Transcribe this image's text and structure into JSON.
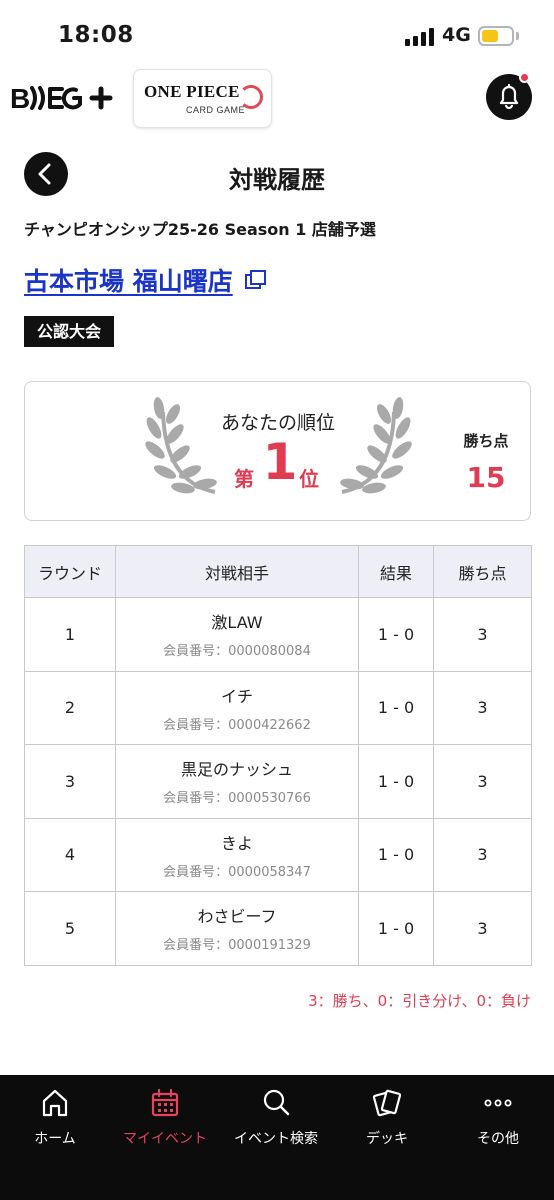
{
  "status_bar": {
    "time": "18:08",
    "network": "4G"
  },
  "header": {
    "brand_logo": "B#SG+",
    "game_logo_title": "ONE PIECE",
    "game_logo_subtitle": "CARD GAME",
    "bell_icon": "bell-icon"
  },
  "page": {
    "title": "対戦履歴",
    "event_name": "チャンピオンシップ25-26 Season 1 店舗予選",
    "store_name": "古本市場 福山曙店",
    "badge": "公認大会"
  },
  "rank_card": {
    "label": "あなたの順位",
    "prefix": "第",
    "rank": "1",
    "suffix": "位",
    "points_label": "勝ち点",
    "points_value": "15"
  },
  "table": {
    "headers": {
      "round": "ラウンド",
      "opponent": "対戦相手",
      "result": "結果",
      "points": "勝ち点"
    },
    "rows": [
      {
        "round": "1",
        "opponent": "激LAW",
        "member_id": "会員番号：0000080084",
        "result": "1 - 0",
        "points": "3"
      },
      {
        "round": "2",
        "opponent": "イチ",
        "member_id": "会員番号：0000422662",
        "result": "1 - 0",
        "points": "3"
      },
      {
        "round": "3",
        "opponent": "黒足のナッシュ",
        "member_id": "会員番号：0000530766",
        "result": "1 - 0",
        "points": "3"
      },
      {
        "round": "4",
        "opponent": "きよ",
        "member_id": "会員番号：0000058347",
        "result": "1 - 0",
        "points": "3"
      },
      {
        "round": "5",
        "opponent": "わさビーフ",
        "member_id": "会員番号：0000191329",
        "result": "1 - 0",
        "points": "3"
      }
    ]
  },
  "legend_note": "3：勝ち、0：引き分け、0：負け",
  "bottom_nav": [
    {
      "label": "ホーム",
      "icon": "home-icon"
    },
    {
      "label": "マイイベント",
      "icon": "calendar-icon",
      "active": true
    },
    {
      "label": "イベント検索",
      "icon": "search-icon"
    },
    {
      "label": "デッキ",
      "icon": "cards-icon"
    },
    {
      "label": "その他",
      "icon": "more-icon"
    }
  ],
  "colors": {
    "accent": "#e03d52",
    "link": "#1a35c7",
    "nav_bg": "#0c0c0c",
    "table_header_bg": "#edeef6"
  }
}
